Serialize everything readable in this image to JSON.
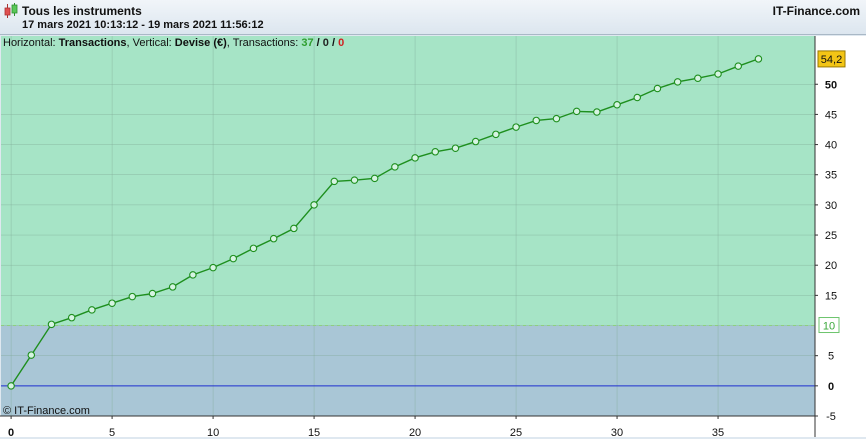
{
  "header": {
    "title": "Tous les instruments",
    "date_range": "17 mars 2021 10:13:12 - 19 mars 2021 11:56:12",
    "brand": "IT-Finance.com"
  },
  "info_bar": {
    "horizontal_label": "Horizontal: ",
    "horizontal_value": "Transactions",
    "vertical_label": ", Vertical: ",
    "vertical_value": "Devise (€)",
    "transactions_label": ", Transactions: ",
    "count_total": "37",
    "sep1": " / ",
    "count_zero": "0",
    "sep2": " / ",
    "count_neg": "0"
  },
  "watermark": "© IT-Finance.com",
  "colors": {
    "line": "#1e8f1e",
    "above_threshold": "#a6e4c6",
    "below_threshold": "#a9c6d6",
    "zero_line": "#1f2fd0",
    "last_value_badge": "#f3c516",
    "threshold_label": "#3aa83a"
  },
  "chart_data": {
    "type": "line",
    "xlim": [
      -0.5,
      39.8
    ],
    "ylim": [
      -5,
      58
    ],
    "x_ticks": [
      0,
      5,
      10,
      15,
      20,
      25,
      30,
      35
    ],
    "y_ticks": [
      -5,
      0,
      5,
      10,
      15,
      20,
      25,
      30,
      35,
      40,
      45,
      50
    ],
    "threshold": 10,
    "threshold_label": "10",
    "last_value_label": "54,2",
    "grid": true,
    "series": [
      {
        "x": [
          0,
          1,
          2,
          3,
          4,
          5,
          6,
          7,
          8,
          9,
          10,
          11,
          12,
          13,
          14,
          15,
          16,
          17,
          18,
          19,
          20,
          21,
          22,
          23,
          24,
          25,
          26,
          27,
          28,
          29,
          30,
          31,
          32,
          33,
          34,
          35,
          36,
          37
        ],
        "values": [
          0,
          5.1,
          10.2,
          11.3,
          12.6,
          13.7,
          14.8,
          15.3,
          16.4,
          18.4,
          19.6,
          21.1,
          22.8,
          24.4,
          26.1,
          30.0,
          33.9,
          34.1,
          34.4,
          36.3,
          37.8,
          38.8,
          39.4,
          40.5,
          41.7,
          42.9,
          44.0,
          44.3,
          45.5,
          45.4,
          46.6,
          47.8,
          49.3,
          50.4,
          51.0,
          51.7,
          53.0,
          54.2
        ]
      }
    ]
  }
}
